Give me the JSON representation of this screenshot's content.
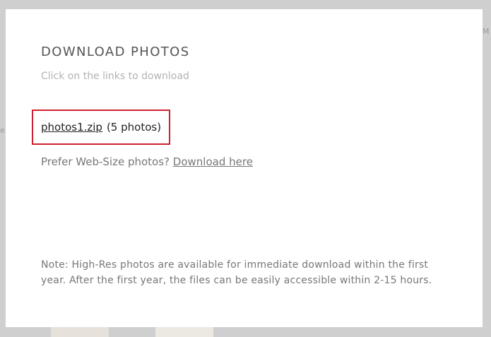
{
  "modal": {
    "title": "DOWNLOAD PHOTOS",
    "subtitle": "Click on the links to download",
    "files": [
      {
        "link_text": "photos1.zip",
        "count_text": "(5 photos)"
      }
    ],
    "websize": {
      "prompt": "Prefer Web-Size photos?",
      "link_text": "Download here"
    },
    "note": "Note: High-Res photos are available for immediate download within the first year. After the first year, the files can be easily accessible within 2-15 hours."
  },
  "background": {
    "peek_right": "M",
    "peek_left": "e"
  },
  "colors": {
    "highlight_border": "#d0202f",
    "overlay": "#cfcfcf",
    "modal_bg": "#ffffff"
  }
}
